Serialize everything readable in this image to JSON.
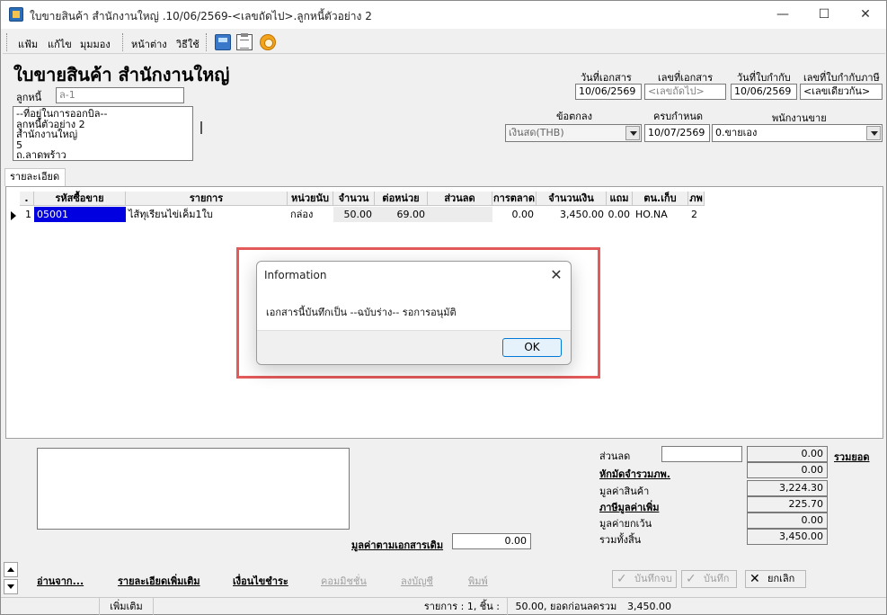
{
  "window": {
    "title": "ใบขายสินค้า สำนักงานใหญ่ .10/06/2569-<เลขถัดไป>.ลูกหนี้ตัวอย่าง 2",
    "min_glyph": "—",
    "max_glyph": "☐",
    "close_glyph": "✕"
  },
  "menu": {
    "file": "แฟ้ม",
    "edit": "แก้ไข",
    "view": "มุมมอง",
    "window": "หน้าต่าง",
    "howto": "วิธีใช้"
  },
  "form": {
    "heading": "ใบขายสินค้า สำนักงานใหญ่",
    "debtor_label": "ลูกหนี้",
    "debtor_value": "ล-1",
    "address_lines": [
      "--ที่อยู่ในการออกบิล--",
      "ลูกหนี้ตัวอย่าง 2",
      "สำนักงานใหญ่",
      "5",
      "ถ.ลาดพร้าว"
    ],
    "doc_date_label": "วันที่เอกสาร",
    "doc_date": "10/06/2569",
    "doc_no_label": "เลขที่เอกสาร",
    "doc_no": "<เลขถัดไป>",
    "tax_date_label": "วันที่ใบกำกับ",
    "tax_date": "10/06/2569",
    "tax_no_label": "เลขที่ใบกำกับภาษี",
    "tax_no": "<เลขเดียวกัน>",
    "terms_label": "ข้อตกลง",
    "terms_value": "เงินสด(THB)",
    "due_label": "ครบกำหนด",
    "due_value": "10/07/2569",
    "salesman_label": "พนักงานขาย",
    "salesman_value": "0.ขายเอง"
  },
  "tabs": {
    "detail": "รายละเอียด"
  },
  "grid": {
    "headers": {
      "idx": ".",
      "code": "รหัสซื้อขาย",
      "item": "รายการ",
      "unit": "หน่วยนับ",
      "qty": "จำนวน",
      "price": "ต่อหน่วย",
      "discount": "ส่วนลด",
      "marketing": "การตลาด",
      "amount": "จำนวนเงิน",
      "free": "แถม",
      "store": "ตน.เก็บ",
      "vat": "ภพ"
    },
    "rows": [
      {
        "idx": "1",
        "code": "05001",
        "item": "ไส้ทุเรียนไข่เค็ม1ใบ",
        "unit": "กล่อง",
        "qty": "50.00",
        "price": "69.00",
        "discount": "",
        "marketing": "0.00",
        "amount": "3,450.00",
        "free": "0.00",
        "store": "HO.NA",
        "vat": "2"
      }
    ]
  },
  "dialog": {
    "title": "Information",
    "close_glyph": "✕",
    "message": "เอกสารนี้บันทึกเป็น --ฉบับร่าง-- รอการอนุมัติ",
    "ok": "OK"
  },
  "summary": {
    "discount_label": "ส่วนลด",
    "discount_input": "",
    "discount_value": "0.00",
    "total_link": "รวมยอด",
    "withholding_label": "หักมัดจำรวมภพ.",
    "withholding_value": "0.00",
    "goods_value_label": "มูลค่าสินค้า",
    "goods_value": "3,224.30",
    "vat_label": "ภาษีมูลค่าเพิ่ม",
    "vat_value": "225.70",
    "exempt_label": "มูลค่ายกเว้น",
    "exempt_value": "0.00",
    "grand_total_label": "รวมทั้งสิ้น",
    "grand_total_value": "3,450.00",
    "ref_value_label": "มูลค่าตามเอกสารเดิม",
    "ref_value": "0.00"
  },
  "actions": {
    "read_from": "อ่านจาก...",
    "more_detail": "รายละเอียดเพิ่มเติม",
    "payment_terms": "เงื่อนไขชำระ",
    "commission": "คอมมิชชั่น",
    "post": "ลงบัญชี",
    "print": "พิมพ์",
    "save_close": "บันทึกจบ",
    "save": "บันทึก",
    "cancel": "ยกเลิก"
  },
  "status": {
    "add": "เพิ่มเติม",
    "summary": "รายการ : 1, ชิ้น :",
    "pieces": "50.00",
    "before_discount_label": ", ยอดก่อนลดรวม :",
    "before_discount": "3,450.00"
  }
}
